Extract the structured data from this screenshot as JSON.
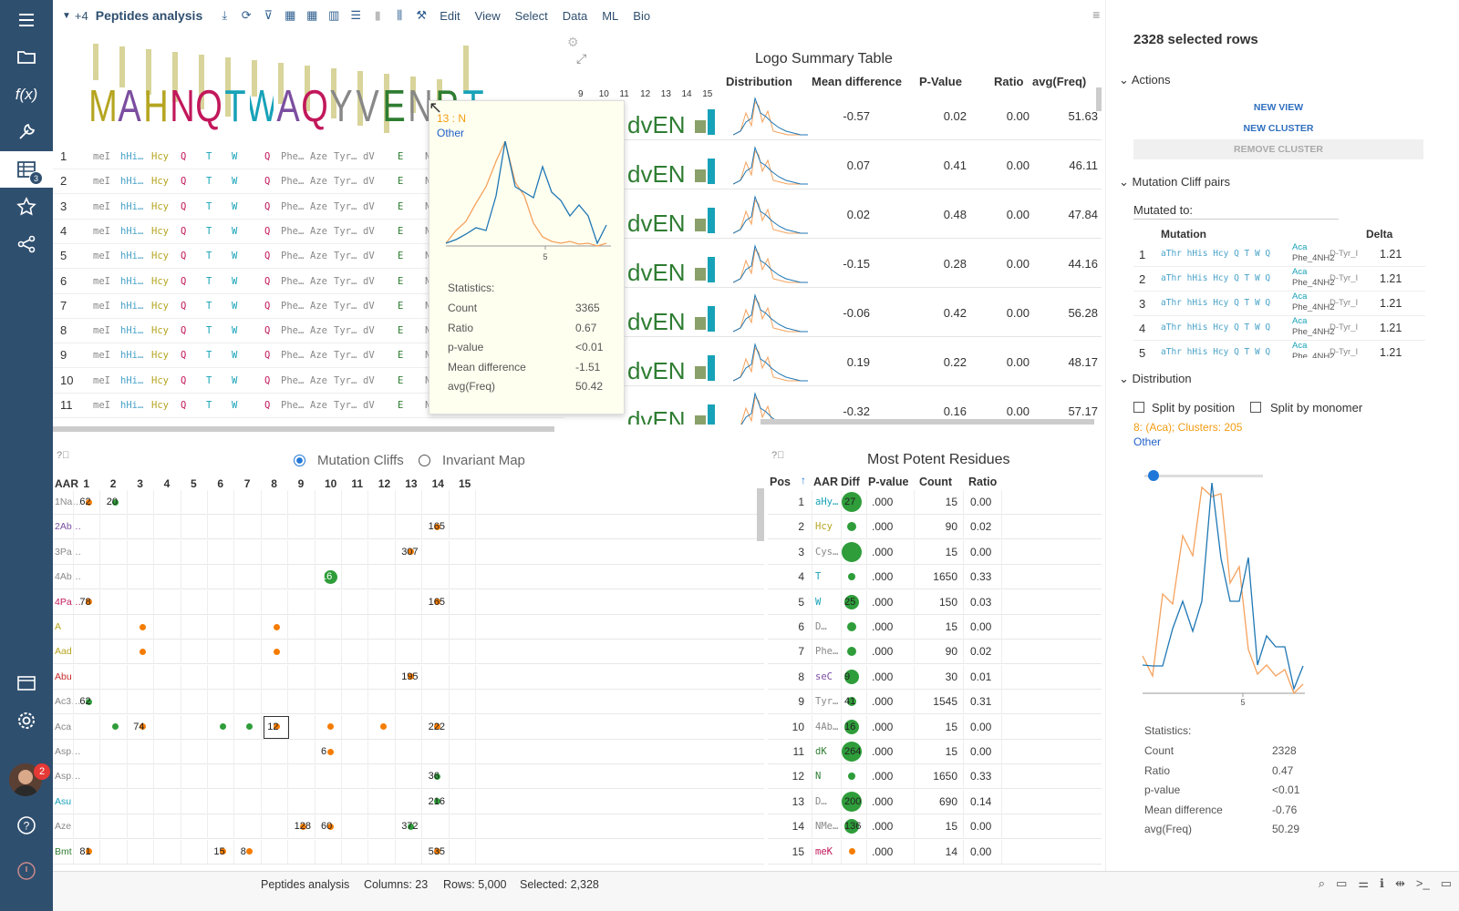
{
  "app": {
    "title": "Peptides analysis",
    "tab_count": "+4",
    "menu": [
      "Edit",
      "View",
      "Select",
      "Data",
      "ML",
      "Bio"
    ]
  },
  "sidebar": {
    "table_badge": "3",
    "avatar_badge": "2",
    "icons": [
      "menu-icon",
      "folder-icon",
      "function-icon",
      "wrench-icon",
      "table-icon",
      "star-icon",
      "share-icon",
      "browse-icon",
      "settings-icon",
      "help-icon",
      "notification-icon"
    ]
  },
  "logo_table": {
    "title": "Logo Summary Table",
    "columns": [
      "Distribution",
      "Mean difference",
      "P-Value",
      "Ratio",
      "avg(Freq)"
    ],
    "position_labels": [
      "9",
      "10",
      "11",
      "12",
      "13",
      "14",
      "15"
    ],
    "rows": [
      [
        "-0.57",
        "0.02",
        "0.00",
        "51.63"
      ],
      [
        "0.07",
        "0.41",
        "0.00",
        "46.11"
      ],
      [
        "0.02",
        "0.48",
        "0.00",
        "47.84"
      ],
      [
        "-0.15",
        "0.28",
        "0.00",
        "44.16"
      ],
      [
        "-0.06",
        "0.42",
        "0.00",
        "56.28"
      ],
      [
        "0.19",
        "0.22",
        "0.00",
        "48.17"
      ],
      [
        "-0.32",
        "0.16",
        "0.00",
        "57.17"
      ]
    ]
  },
  "sequences": {
    "rows": [
      "1",
      "2",
      "3",
      "4",
      "5",
      "6",
      "7",
      "8",
      "9",
      "10",
      "11"
    ],
    "cells": [
      {
        "t": "meI",
        "c": "#888"
      },
      {
        "t": "hHi…",
        "c": "#4aa3c9"
      },
      {
        "t": "Hcy",
        "c": "#b5a520"
      },
      {
        "t": "Q",
        "c": "#c2185b"
      },
      {
        "t": "T",
        "c": "#17a2b8"
      },
      {
        "t": "W",
        "c": "#17a2b8"
      },
      {
        "t": "Q",
        "c": "#c2185b"
      },
      {
        "t": "Phe…",
        "c": "#888"
      },
      {
        "t": "Aze",
        "c": "#888"
      },
      {
        "t": "Tyr…",
        "c": "#888"
      },
      {
        "t": "dV",
        "c": "#888"
      },
      {
        "t": "E",
        "c": "#2e7d32"
      },
      {
        "t": "N",
        "c": "#888"
      }
    ]
  },
  "tooltip": {
    "title": "13 : N",
    "other": "Other",
    "axis_tick": "5",
    "stats_label": "Statistics:",
    "stats": [
      [
        "Count",
        "3365"
      ],
      [
        "Ratio",
        "0.67"
      ],
      [
        "p-value",
        "<0.01"
      ],
      [
        "Mean difference",
        "-1.51"
      ],
      [
        "avg(Freq)",
        "50.42"
      ]
    ]
  },
  "right_panel": {
    "selected": "2328 selected rows",
    "actions": "Actions",
    "new_view": "NEW VIEW",
    "new_cluster": "NEW CLUSTER",
    "remove_cluster": "REMOVE CLUSTER",
    "mutation_cliff_pairs": "Mutation Cliff pairs",
    "mutated_to": "Mutated to:",
    "mc_columns": [
      "Mutation",
      "Delta"
    ],
    "mc_rows": [
      [
        "1",
        "1.21"
      ],
      [
        "2",
        "1.21"
      ],
      [
        "3",
        "1.21"
      ],
      [
        "4",
        "1.21"
      ],
      [
        "5",
        "1.21"
      ]
    ],
    "mc_seq": "aThr hHis Hcy Q T W Q",
    "mc_aca": "Aca",
    "mc_phe": "Phe_4NH2",
    "mc_tyr": "D-Tyr_I",
    "distribution": "Distribution",
    "split_position": "Split by position",
    "split_monomer": "Split by monomer",
    "legend_sel": "8: (Aca); Clusters: 205",
    "legend_other": "Other",
    "axis_tick": "5",
    "stats_label": "Statistics:",
    "stats": [
      [
        "Count",
        "2328"
      ],
      [
        "Ratio",
        "0.47"
      ],
      [
        "p-value",
        "<0.01"
      ],
      [
        "Mean difference",
        "-0.76"
      ],
      [
        "avg(Freq)",
        "50.29"
      ]
    ]
  },
  "mutation_cliffs": {
    "radio_cliffs": "Mutation Cliffs",
    "radio_invariant": "Invariant Map",
    "aar": "AAR",
    "positions": [
      "1",
      "2",
      "3",
      "4",
      "5",
      "6",
      "7",
      "8",
      "9",
      "10",
      "11",
      "12",
      "13",
      "14",
      "15"
    ],
    "rows": [
      {
        "l": "1Na…",
        "c": "#888",
        "cells": [
          [
            1,
            "62",
            "o"
          ],
          [
            2,
            "20",
            "g"
          ]
        ]
      },
      {
        "l": "2Ab…",
        "c": "#7b4ea0",
        "cells": [
          [
            14,
            "165",
            "o"
          ]
        ]
      },
      {
        "l": "3Pa…",
        "c": "#888",
        "cells": [
          [
            13,
            "307",
            "o"
          ]
        ]
      },
      {
        "l": "4Ab…",
        "c": "#888",
        "cells": [
          [
            10,
            "16",
            "G"
          ]
        ]
      },
      {
        "l": "4Pa…",
        "c": "#c2185b",
        "cells": [
          [
            1,
            "78",
            "o"
          ],
          [
            14,
            "165",
            "o"
          ]
        ]
      },
      {
        "l": "A",
        "c": "#b5a520",
        "cells": [
          [
            3,
            "",
            "o"
          ],
          [
            8,
            "",
            "o"
          ]
        ]
      },
      {
        "l": "Aad",
        "c": "#b5a520",
        "cells": [
          [
            3,
            "",
            "o"
          ],
          [
            8,
            "",
            "o"
          ]
        ]
      },
      {
        "l": "Abu",
        "c": "#c62828",
        "cells": [
          [
            13,
            "195",
            "o"
          ]
        ]
      },
      {
        "l": "Ac3…",
        "c": "#888",
        "cells": [
          [
            1,
            "62",
            "g"
          ]
        ]
      },
      {
        "l": "Aca",
        "c": "#888",
        "cells": [
          [
            2,
            "",
            "g"
          ],
          [
            3,
            "74",
            "o"
          ],
          [
            6,
            "",
            "g"
          ],
          [
            7,
            "",
            "g"
          ],
          [
            8,
            "12",
            "o"
          ],
          [
            10,
            "",
            "o"
          ],
          [
            12,
            "",
            "o"
          ],
          [
            14,
            "222",
            "o"
          ]
        ]
      },
      {
        "l": "Asp…",
        "c": "#888",
        "cells": [
          [
            10,
            "6",
            "o"
          ]
        ]
      },
      {
        "l": "Asp…",
        "c": "#888",
        "cells": [
          [
            14,
            "36",
            "g"
          ]
        ]
      },
      {
        "l": "Asu",
        "c": "#17a2b8",
        "cells": [
          [
            14,
            "216",
            "g"
          ]
        ]
      },
      {
        "l": "Aze",
        "c": "#888",
        "cells": [
          [
            9,
            "128",
            "o"
          ],
          [
            10,
            "60",
            "o"
          ],
          [
            13,
            "372",
            "g"
          ]
        ]
      },
      {
        "l": "Bmt",
        "c": "#2e7d32",
        "cells": [
          [
            1,
            "81",
            "o"
          ],
          [
            6,
            "15",
            "o"
          ],
          [
            7,
            "8",
            "o"
          ],
          [
            14,
            "535",
            "o"
          ]
        ]
      }
    ]
  },
  "potent": {
    "title": "Most Potent Residues",
    "columns": [
      "Pos",
      "AAR",
      "Diff",
      "P-value",
      "Count",
      "Ratio"
    ],
    "rows": [
      [
        "1",
        "aHy…",
        "#17a2b8",
        "27",
        "big",
        ".000",
        "15",
        "0.00"
      ],
      [
        "2",
        "Hcy",
        "#b5a520",
        "",
        "small",
        ".000",
        "90",
        "0.02"
      ],
      [
        "3",
        "Cys…",
        "#888",
        "",
        "big",
        ".000",
        "15",
        "0.00"
      ],
      [
        "4",
        "T",
        "#17a2b8",
        "",
        "tiny",
        ".000",
        "1650",
        "0.33"
      ],
      [
        "5",
        "W",
        "#17a2b8",
        "25",
        "med",
        ".000",
        "150",
        "0.03"
      ],
      [
        "6",
        "D…",
        "#888",
        "",
        "small",
        ".000",
        "15",
        "0.00"
      ],
      [
        "7",
        "Phe…",
        "#888",
        "",
        "small",
        ".000",
        "90",
        "0.02"
      ],
      [
        "8",
        "seC",
        "#7b4ea0",
        "9",
        "med",
        ".000",
        "30",
        "0.01"
      ],
      [
        "9",
        "Tyr…",
        "#888",
        "41",
        "small",
        ".000",
        "1545",
        "0.31"
      ],
      [
        "10",
        "4Ab…",
        "#888",
        "16",
        "med",
        ".000",
        "15",
        "0.00"
      ],
      [
        "11",
        "dK",
        "#2e7d32",
        "264",
        "big",
        ".000",
        "15",
        "0.00"
      ],
      [
        "12",
        "N",
        "#2e7d32",
        "",
        "tiny",
        ".000",
        "1650",
        "0.33"
      ],
      [
        "13",
        "D…",
        "#888",
        "200",
        "big",
        ".000",
        "690",
        "0.14"
      ],
      [
        "14",
        "NMe…",
        "#888",
        "136",
        "med",
        ".000",
        "15",
        "0.00"
      ],
      [
        "15",
        "meK",
        "#c2185b",
        "",
        "orange",
        ".000",
        "14",
        "0.00"
      ]
    ]
  },
  "status": {
    "name": "Peptides analysis",
    "columns": "Columns: 23",
    "rows": "Rows: 5,000",
    "selected": "Selected: 2,328"
  }
}
